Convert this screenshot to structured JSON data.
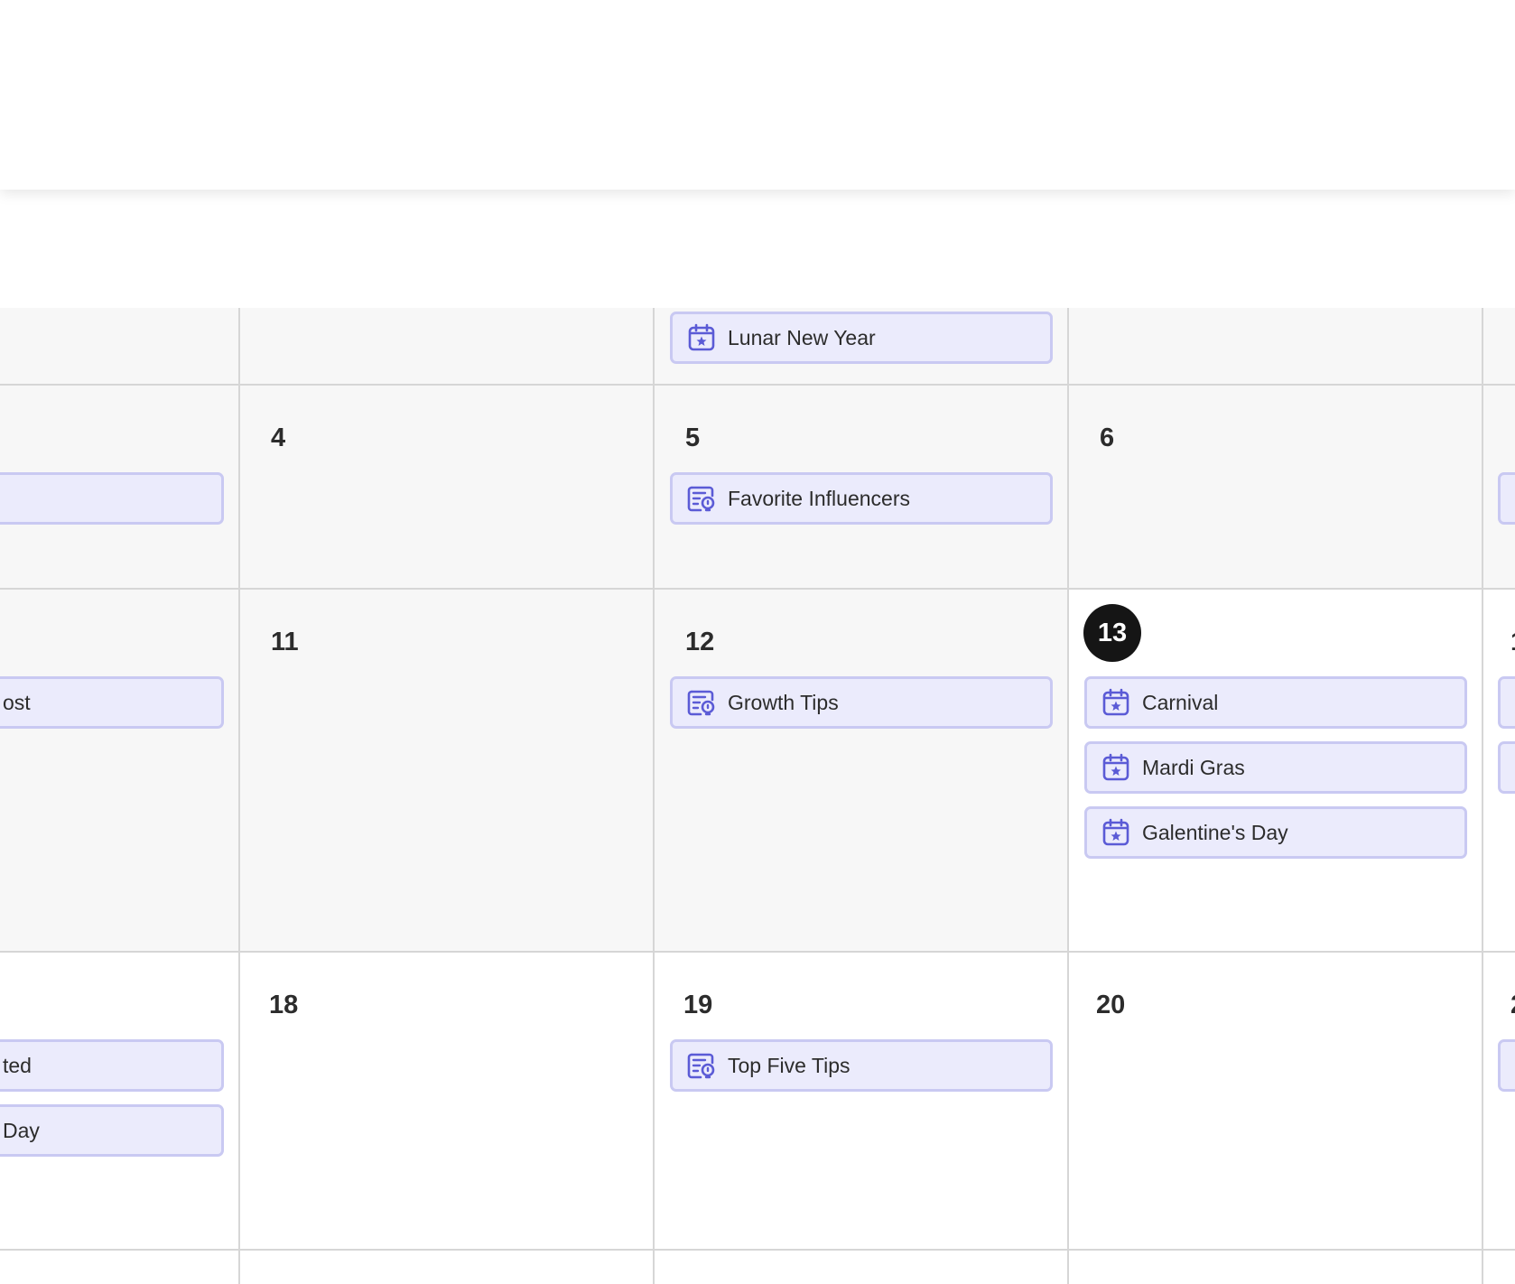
{
  "colors": {
    "event_bg": "#ebebfc",
    "event_border": "#c9c9f2",
    "icon": "#5b5bd6",
    "today_badge": "#151515",
    "grid_line": "#d6d6d6"
  },
  "calendar": {
    "row0": {
      "col2_event": {
        "label": "Lunar New Year",
        "icon": "calendar-star-icon"
      }
    },
    "row1": {
      "col1_day": "4",
      "col2_day": "5",
      "col2_event": {
        "label": "Favorite Influencers",
        "icon": "post-idea-icon"
      },
      "col3_day": "6"
    },
    "row2": {
      "col0_event": {
        "label": "ost"
      },
      "col1_day": "11",
      "col2_day": "12",
      "col2_event": {
        "label": "Growth Tips",
        "icon": "post-idea-icon"
      },
      "col3_day": "13",
      "col3_events": [
        {
          "label": "Carnival",
          "icon": "calendar-star-icon"
        },
        {
          "label": "Mardi Gras",
          "icon": "calendar-star-icon"
        },
        {
          "label": "Galentine's Day",
          "icon": "calendar-star-icon"
        }
      ],
      "col4_day": "1"
    },
    "row3": {
      "col0_events": [
        {
          "label": "ted"
        },
        {
          "label": "Day"
        }
      ],
      "col1_day": "18",
      "col2_day": "19",
      "col2_event": {
        "label": "Top Five Tips",
        "icon": "post-idea-icon"
      },
      "col3_day": "20",
      "col4_day": "2"
    }
  }
}
